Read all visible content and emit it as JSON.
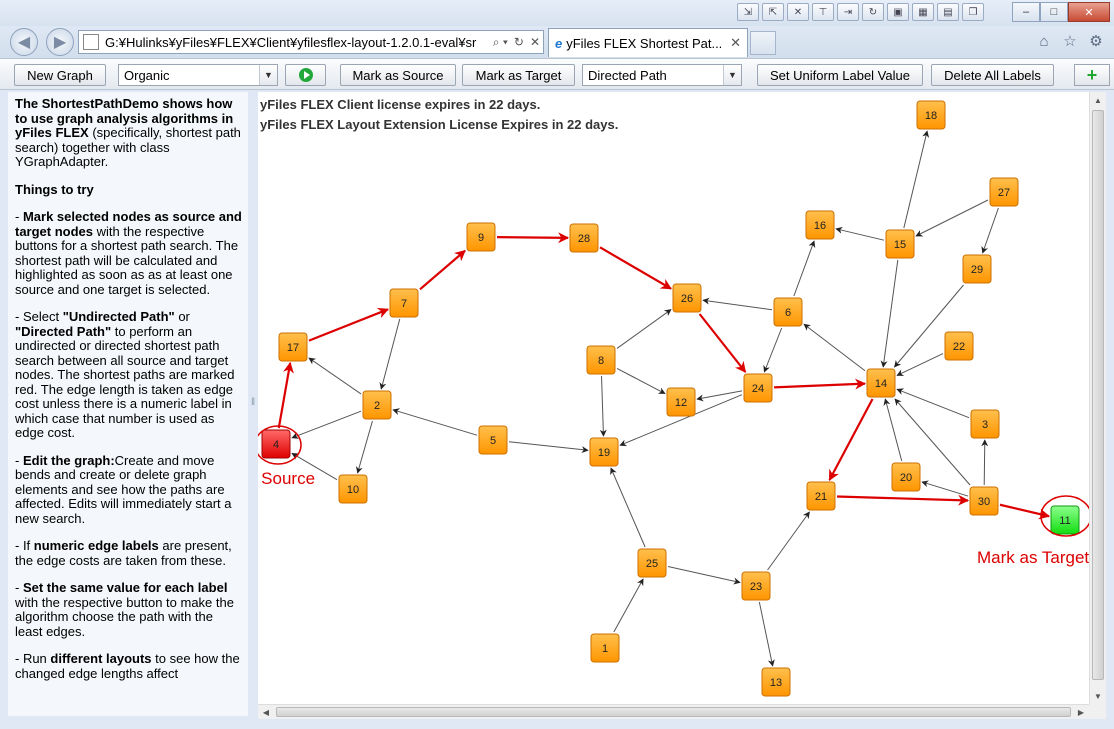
{
  "browser": {
    "address": "G:¥Hulinks¥yFiles¥FLEX¥Client¥yfilesflex-layout-1.2.0.1-eval¥sr",
    "tab_title": "yFiles FLEX Shortest Pat...",
    "tab_icon": "e"
  },
  "toolbar": {
    "new_graph": "New Graph",
    "layout_select": "Organic",
    "mark_source": "Mark as Source",
    "mark_target": "Mark as Target",
    "path_select": "Directed Path",
    "set_uniform": "Set Uniform Label Value",
    "delete_labels": "Delete All Labels"
  },
  "help": {
    "intro_bold": "The ShortestPathDemo shows how to use graph analysis algorithms in yFiles FLEX",
    "intro_rest": " (specifically, shortest path search) together with class YGraphAdapter.",
    "things_heading": "Things to try",
    "mark_prefix": "- ",
    "mark_bold": "Mark selected nodes as source and target nodes",
    "mark_rest": " with the respective buttons for a shortest path search. The shortest path will be calculated and highlighted as soon as as at least one source and one target is selected.",
    "select_prefix": "- Select ",
    "select_bold1": "\"Undirected Path\"",
    "select_or": " or ",
    "select_bold2": "\"Directed Path\"",
    "select_rest": " to perform an undirected or directed shortest path search between all source and target nodes. The shortest paths are marked red. The edge length is taken as edge cost unless there is a numeric label in which case that number is used as edge cost.",
    "edit_prefix": "- ",
    "edit_bold": "Edit the graph:",
    "edit_rest": "Create and move bends and create or delete graph elements and see how the paths are affected. Edits will immediately start a new search.",
    "numeric_prefix": "- If ",
    "numeric_bold": "numeric edge labels",
    "numeric_rest": " are present, the edge costs are taken from these.",
    "same_prefix": "- ",
    "same_bold": "Set the same value for each label",
    "same_rest": " with the respective button to make the algorithm choose the path with the least edges.",
    "run_prefix": "- Run ",
    "run_bold": "different layouts",
    "run_rest": " to see how the changed edge lengths affect"
  },
  "license": {
    "client": "yFiles FLEX Client license expires in 22 days.",
    "layout": "yFiles FLEX Layout Extension License Expires in 22 days."
  },
  "annotations": {
    "source_label": "Mark as Source",
    "target_label": "Mark as Target"
  },
  "colors": {
    "node_fill": "#ff9900",
    "node_stroke": "#cc7000",
    "source_fill": "#ee1111",
    "target_fill": "#22ee22",
    "path_edge": "#dd0000",
    "normal_edge": "#555555",
    "annotation": "#dd0000"
  },
  "graph": {
    "source": "4",
    "target": "11",
    "nodes": [
      "1",
      "2",
      "3",
      "4",
      "5",
      "6",
      "7",
      "8",
      "9",
      "10",
      "11",
      "12",
      "13",
      "14",
      "15",
      "16",
      "17",
      "18",
      "19",
      "20",
      "21",
      "22",
      "23",
      "24",
      "25",
      "26",
      "27",
      "28",
      "29",
      "30"
    ],
    "edges": [
      {
        "from": "4",
        "to": "17",
        "path": true
      },
      {
        "from": "17",
        "to": "7",
        "path": true
      },
      {
        "from": "7",
        "to": "9",
        "path": true
      },
      {
        "from": "9",
        "to": "28",
        "path": true
      },
      {
        "from": "28",
        "to": "26",
        "path": true
      },
      {
        "from": "26",
        "to": "24",
        "path": true
      },
      {
        "from": "24",
        "to": "14",
        "path": true
      },
      {
        "from": "14",
        "to": "21",
        "path": true
      },
      {
        "from": "21",
        "to": "30",
        "path": true
      },
      {
        "from": "30",
        "to": "11",
        "path": true
      },
      {
        "from": "2",
        "to": "17",
        "path": false
      },
      {
        "from": "2",
        "to": "4",
        "path": false
      },
      {
        "from": "2",
        "to": "10",
        "path": false
      },
      {
        "from": "7",
        "to": "2",
        "path": false
      },
      {
        "from": "10",
        "to": "4",
        "path": false
      },
      {
        "from": "5",
        "to": "2",
        "path": false
      },
      {
        "from": "5",
        "to": "19",
        "path": false
      },
      {
        "from": "8",
        "to": "26",
        "path": false
      },
      {
        "from": "8",
        "to": "12",
        "path": false
      },
      {
        "from": "8",
        "to": "19",
        "path": false
      },
      {
        "from": "24",
        "to": "12",
        "path": false
      },
      {
        "from": "24",
        "to": "19",
        "path": false
      },
      {
        "from": "6",
        "to": "26",
        "path": false
      },
      {
        "from": "6",
        "to": "24",
        "path": false
      },
      {
        "from": "6",
        "to": "16",
        "path": false
      },
      {
        "from": "14",
        "to": "6",
        "path": false
      },
      {
        "from": "15",
        "to": "16",
        "path": false
      },
      {
        "from": "15",
        "to": "18",
        "path": false
      },
      {
        "from": "27",
        "to": "15",
        "path": false
      },
      {
        "from": "27",
        "to": "29",
        "path": false
      },
      {
        "from": "15",
        "to": "14",
        "path": false
      },
      {
        "from": "29",
        "to": "14",
        "path": false
      },
      {
        "from": "22",
        "to": "14",
        "path": false
      },
      {
        "from": "3",
        "to": "14",
        "path": false
      },
      {
        "from": "20",
        "to": "14",
        "path": false
      },
      {
        "from": "30",
        "to": "14",
        "path": false
      },
      {
        "from": "30",
        "to": "3",
        "path": false
      },
      {
        "from": "30",
        "to": "20",
        "path": false
      },
      {
        "from": "23",
        "to": "21",
        "path": false
      },
      {
        "from": "25",
        "to": "23",
        "path": false
      },
      {
        "from": "25",
        "to": "19",
        "path": false
      },
      {
        "from": "1",
        "to": "25",
        "path": false
      },
      {
        "from": "23",
        "to": "13",
        "path": false
      }
    ]
  }
}
